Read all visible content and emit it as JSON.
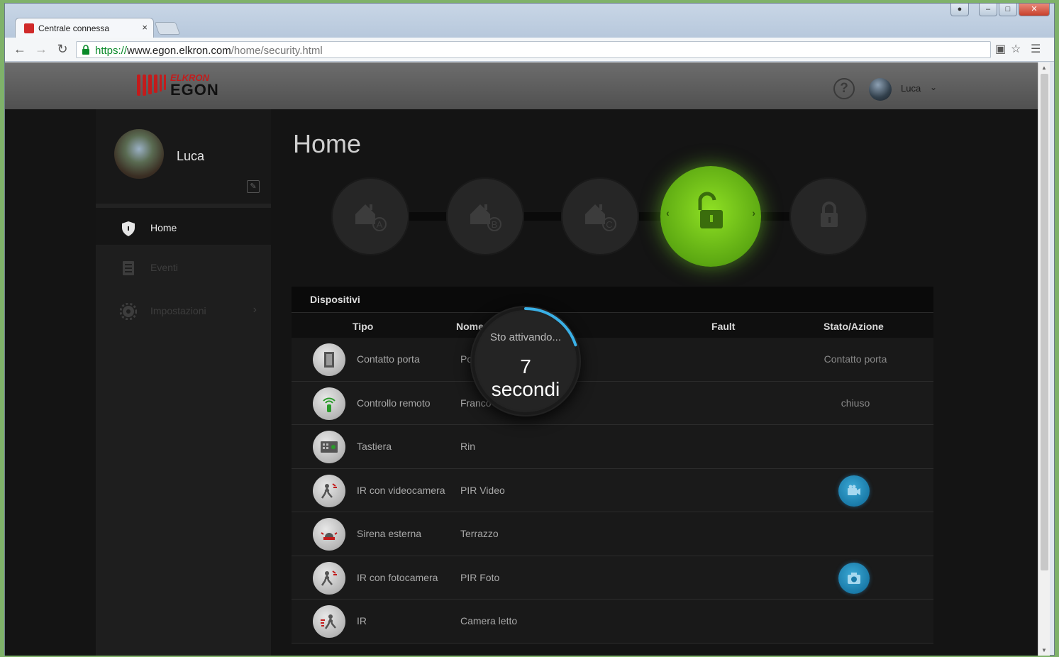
{
  "browser": {
    "tab_title": "Centrale connessa",
    "tab_close": "×",
    "url_scheme": "https://",
    "url_host": "www.egon.elkron.com",
    "url_path": "/home/security.html"
  },
  "header": {
    "brand_top": "ELKRON",
    "brand_main": "EGON",
    "help_label": "?",
    "user_name": "Luca"
  },
  "sidebar": {
    "user_name": "Luca",
    "items": [
      {
        "label": "Home"
      },
      {
        "label": "Eventi"
      },
      {
        "label": "Impostazioni"
      }
    ]
  },
  "main": {
    "title": "Home",
    "modes": [
      {
        "name": "home-a-icon",
        "letter": "A"
      },
      {
        "name": "home-b-icon",
        "letter": "B"
      },
      {
        "name": "home-c-icon",
        "letter": "C"
      },
      {
        "name": "unlock-icon",
        "active": true
      },
      {
        "name": "lock-icon"
      }
    ]
  },
  "devices": {
    "title": "Dispositivi",
    "columns": {
      "tipo": "Tipo",
      "nome": "Nome",
      "fault": "Fault",
      "stato": "Stato/Azione"
    },
    "rows": [
      {
        "tipo": "Contatto porta",
        "nome": "Porta",
        "stato": "Contatto porta",
        "icon": "door-contact-icon"
      },
      {
        "tipo": "Controllo remoto",
        "nome": "Franco",
        "stato": "chiuso",
        "icon": "remote-control-icon"
      },
      {
        "tipo": "Tastiera",
        "nome": "Rin",
        "stato": "",
        "icon": "keypad-icon"
      },
      {
        "tipo": "IR con videocamera",
        "nome": "PIR Video",
        "stato": "",
        "icon": "pir-camera-icon",
        "action": "video-camera-icon"
      },
      {
        "tipo": "Sirena esterna",
        "nome": "Terrazzo",
        "stato": "",
        "icon": "siren-icon"
      },
      {
        "tipo": "IR con fotocamera",
        "nome": "PIR Foto",
        "stato": "",
        "icon": "pir-photo-icon",
        "action": "photo-camera-icon"
      },
      {
        "tipo": "IR",
        "nome": "Camera letto",
        "stato": "",
        "icon": "pir-icon"
      }
    ]
  },
  "overlay": {
    "message": "Sto attivando...",
    "countdown": "7",
    "unit": "secondi",
    "progress": 0.2
  },
  "colors": {
    "active_mode": "#6cc018",
    "action_button": "#1a7aa8",
    "brand": "#c21c1c",
    "spinner": "#3ab0e6"
  }
}
